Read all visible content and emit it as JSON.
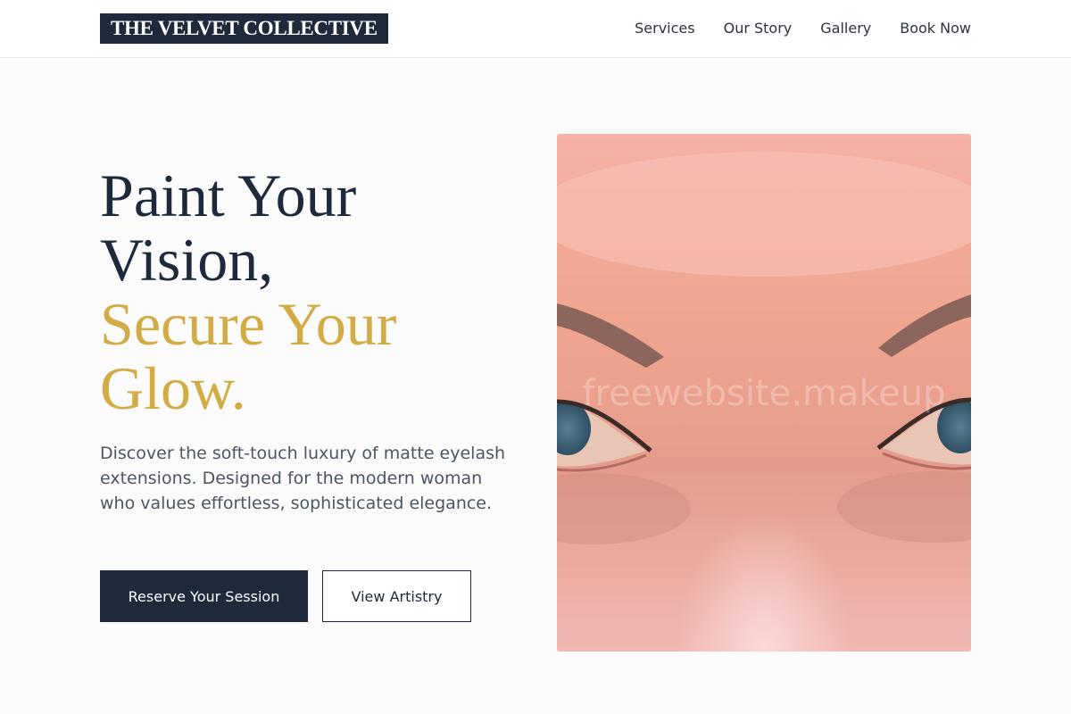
{
  "header": {
    "logo": "THE VELVET COLLECTIVE",
    "nav": [
      "Services",
      "Our Story",
      "Gallery",
      "Book Now"
    ]
  },
  "hero": {
    "headline_dark": [
      "Paint Your",
      "Vision,"
    ],
    "headline_gold": [
      "Secure Your",
      "Glow."
    ],
    "description": "Discover the soft-touch luxury of matte eyelash extensions. Designed for the modern woman who values effortless, sophisticated elegance.",
    "primary_button": "Reserve Your Session",
    "secondary_button": "View Artistry",
    "image_watermark": "freewebsite.makeup"
  },
  "colors": {
    "navy": "#1e293b",
    "gold": "#d2ab45",
    "background": "#fbfbfb"
  }
}
